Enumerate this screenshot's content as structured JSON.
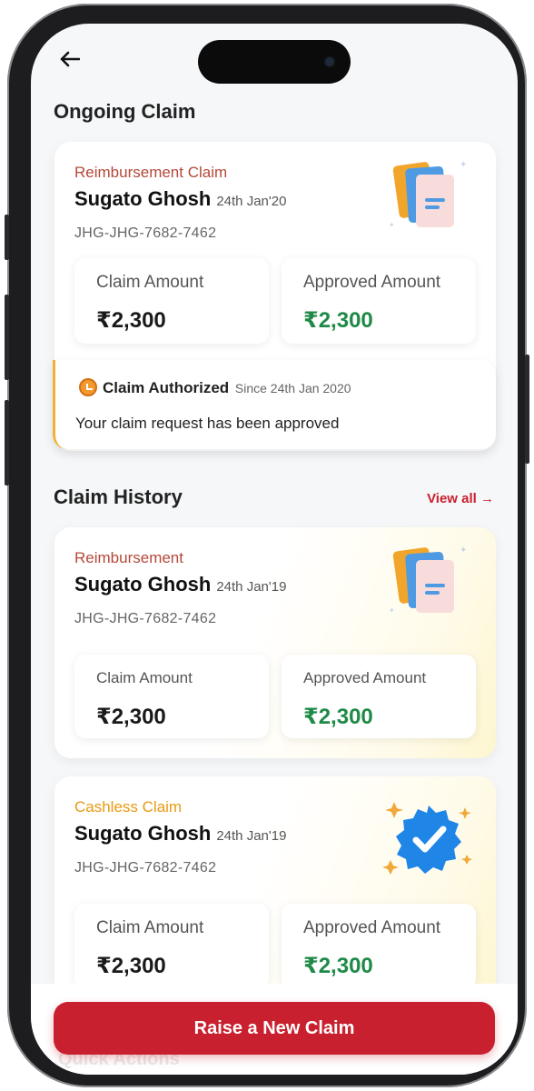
{
  "header": {
    "back_icon": "arrow-left-icon"
  },
  "ongoing": {
    "title": "Ongoing Claim",
    "card": {
      "type": "Reimbursement Claim",
      "type_color": "#b4483a",
      "name": "Sugato Ghosh",
      "date": "24th Jan'20",
      "id": "JHG-JHG-7682-7462",
      "claim_label": "Claim Amount",
      "claim_value": "₹2,300",
      "approved_label": "Approved Amount",
      "approved_value": "₹2,300",
      "illustration": "documents-icon"
    },
    "status": {
      "icon": "alarm-clock-icon",
      "title": "Claim Authorized",
      "since": "Since 24th Jan 2020",
      "message": "Your claim request has been approved"
    }
  },
  "history": {
    "title": "Claim History",
    "view_all": "View all",
    "view_all_icon": "arrow-right-icon",
    "items": [
      {
        "type": "Reimbursement",
        "type_color": "#b4483a",
        "name": "Sugato Ghosh",
        "date": "24th Jan'19",
        "id": "JHG-JHG-7682-7462",
        "claim_label": "Claim Amount",
        "claim_value": "₹2,300",
        "approved_label": "Approved Amount",
        "approved_value": "₹2,300",
        "illustration": "documents-icon"
      },
      {
        "type": "Cashless Claim",
        "type_color": "#e89a10",
        "name": "Sugato Ghosh",
        "date": "24th Jan'19",
        "id": "JHG-JHG-7682-7462",
        "claim_label": "Claim Amount",
        "claim_value": "₹2,300",
        "approved_label": "Approved Amount",
        "approved_value": "₹2,300",
        "illustration": "verified-badge-icon"
      }
    ]
  },
  "footer": {
    "raise_button": "Raise a New Claim",
    "behind_text": "Quick Actions"
  },
  "colors": {
    "accent": "#c8202e",
    "approved": "#1f8a47",
    "status_bar": "#f2b035"
  }
}
